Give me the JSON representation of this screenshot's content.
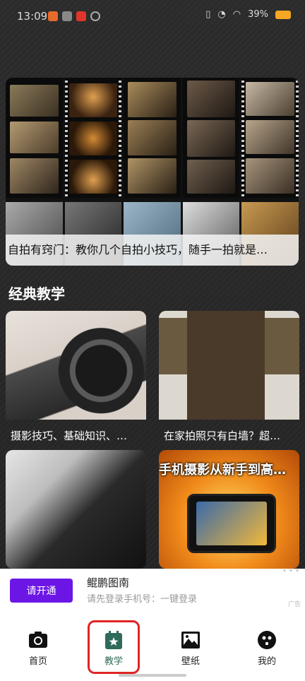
{
  "status_bar": {
    "time": "13:09",
    "battery": "39%"
  },
  "hero": {
    "caption": "自拍有窍门：教你几个自拍小技巧，随手一拍就是…"
  },
  "section": {
    "title": "经典教学"
  },
  "cards": [
    {
      "caption": "摄影技巧、基础知识、…"
    },
    {
      "caption": "在家拍照只有白墙？超…"
    },
    {
      "overlay_text": "手机摄影从新手到高…"
    }
  ],
  "login_banner": {
    "button_label": "请开通",
    "title": "鲲鹏图南",
    "subtitle": "请先登录手机号：一键登录",
    "ad_label": "广告",
    "accent_color": "#6c16e6"
  },
  "nav": {
    "items": [
      {
        "label": "首页",
        "icon": "camera-icon"
      },
      {
        "label": "教学",
        "icon": "calendar-star-icon",
        "active": true
      },
      {
        "label": "壁纸",
        "icon": "image-icon"
      },
      {
        "label": "我的",
        "icon": "profile-icon"
      }
    ],
    "active_color": "#2e6b5a",
    "highlight_color": "#e02424"
  }
}
